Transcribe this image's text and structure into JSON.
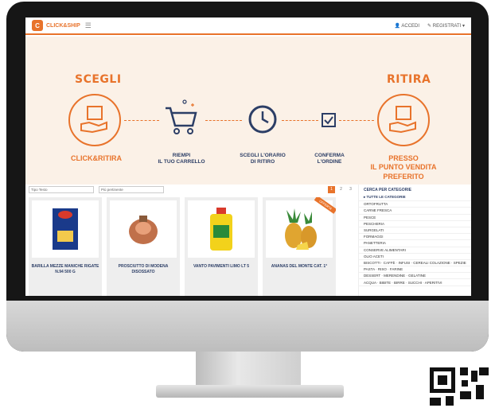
{
  "header": {
    "logo_mark": "C",
    "brand": "CLICK&SHIP",
    "menu_icon": "hamburger-icon",
    "login": "ACCEDI",
    "register": "REGISTRATI"
  },
  "hero": {
    "left_title": "SCEGLI",
    "left_caption": "CLICK&RITIRA",
    "step1": "RIEMPI\nIL TUO CARRELLO",
    "step2": "SCEGLI L'ORARIO\nDI RITIRO",
    "step3": "CONFERMA\nL'ORDINE",
    "right_title": "RITIRA",
    "right_caption": "PRESSO\nIL PUNTO VENDITA\nPREFERITO"
  },
  "filters": {
    "type": "Tipo Testo",
    "sort": "Più pertinente"
  },
  "pager": [
    "1",
    "2",
    "3",
    "»"
  ],
  "products": [
    {
      "name": "BARILLA MEZZE MANICHE RIGATE N.94 500 G"
    },
    {
      "name": "PROSCIUTTO DI MODENA DISOSSATO"
    },
    {
      "name": "VANTO PAVIMENTI LIMO LT 5"
    },
    {
      "name": "ANANAS DEL MONTE CAT. 1°",
      "badge": "OFFERTA"
    }
  ],
  "sidebar": {
    "title": "CERCA PER CATEGORIE",
    "items": [
      "TUTTE LE CATEGORIE",
      "ORTOFRUTTA",
      "CARNE FRESCA",
      "PESCE",
      "PESCHERIA",
      "SURGELATI",
      "FORMAGGI",
      "PANETTERIA",
      "CONSERVE ALIMENTARI",
      "OLIO ACETI",
      "BISCOTTI · CAFFÈ · INFUSI · CEREALI COLAZIONE · SPEZIE",
      "PASTA · RISO · FARINE",
      "DESSERT · MERENDINE · GELATINE",
      "ACQUA · BIBITE · BIRRE · SUCCHI · APERITIVI"
    ]
  },
  "colors": {
    "accent": "#e8732b",
    "navy": "#2c3e66"
  }
}
